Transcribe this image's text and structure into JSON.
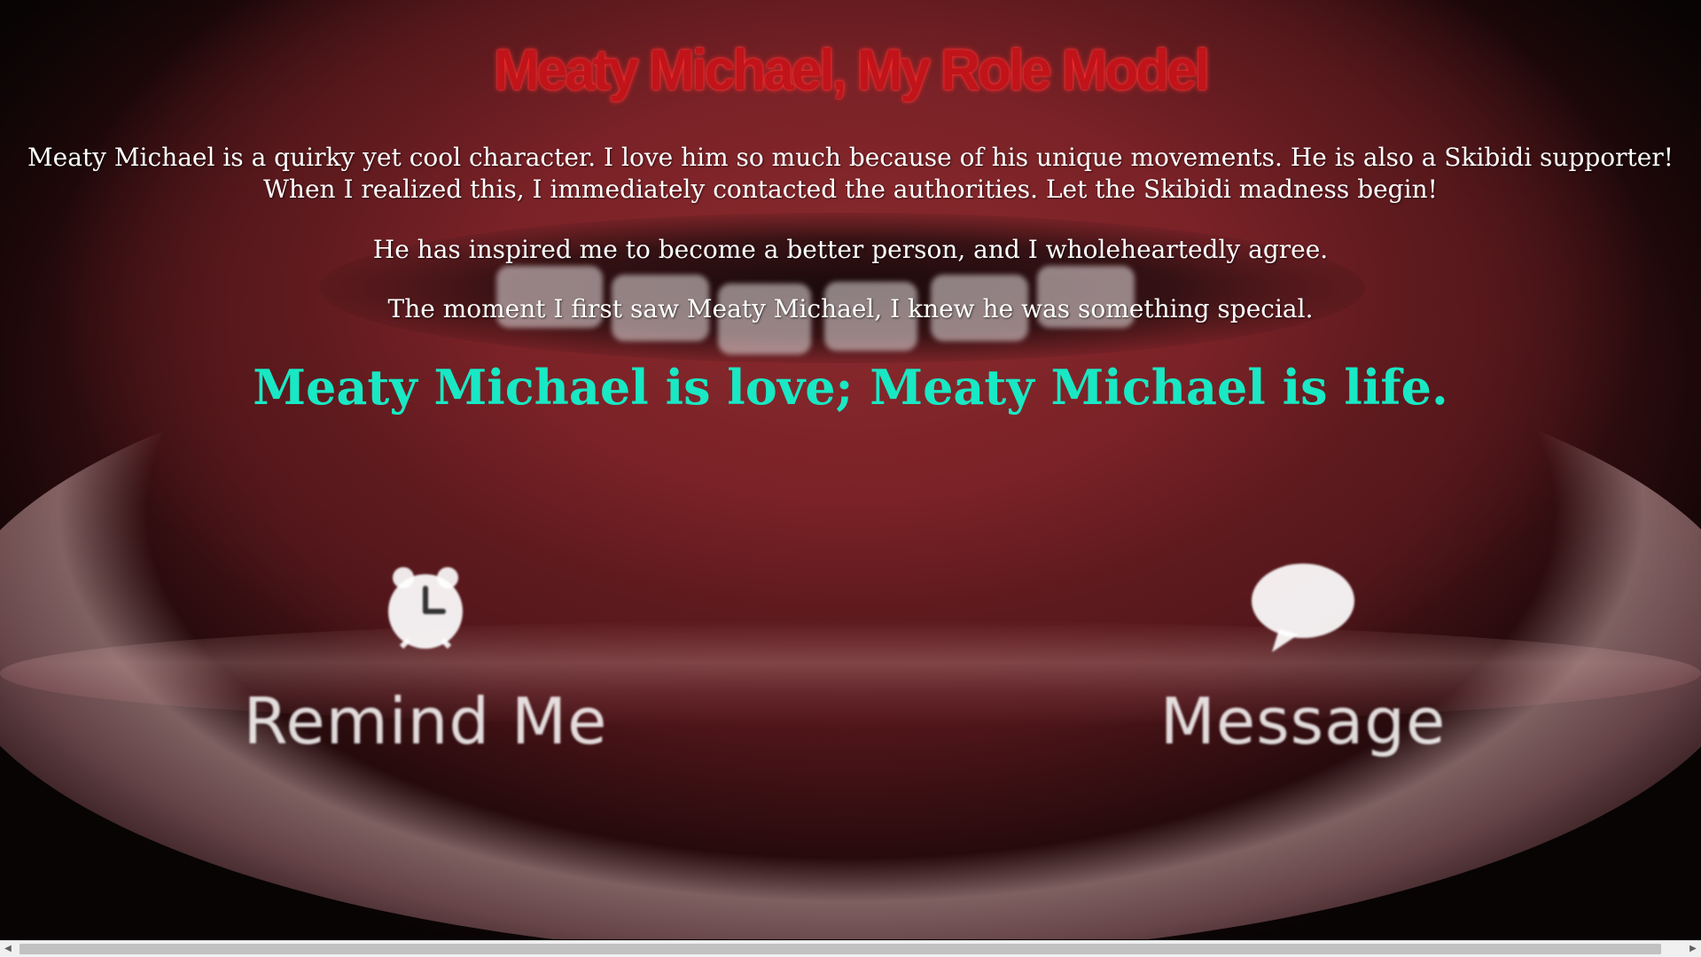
{
  "page": {
    "title": "Meaty Michael, My Role Model",
    "paragraphs": [
      "Meaty Michael is a quirky yet cool character. I love him so much because of his unique movements. He is also a Skibidi supporter! When I realized this, I immediately contacted the authorities. Let the Skibidi madness begin!",
      "He has inspired me to become a better person, and I wholeheartedly agree.",
      "The moment I first saw Meaty Michael, I knew he was something special."
    ],
    "motto": "Meaty Michael is love; Meaty Michael is life."
  },
  "background_image": {
    "actions": [
      {
        "label": "Remind Me",
        "icon": "alarm-clock-icon"
      },
      {
        "label": "Message",
        "icon": "speech-bubble-icon"
      }
    ]
  },
  "scrollbar": {
    "left_arrow": "◀",
    "right_arrow": "▶"
  },
  "colors": {
    "title": "#c0141a",
    "motto": "#19e8c4",
    "text": "#ffffff"
  }
}
